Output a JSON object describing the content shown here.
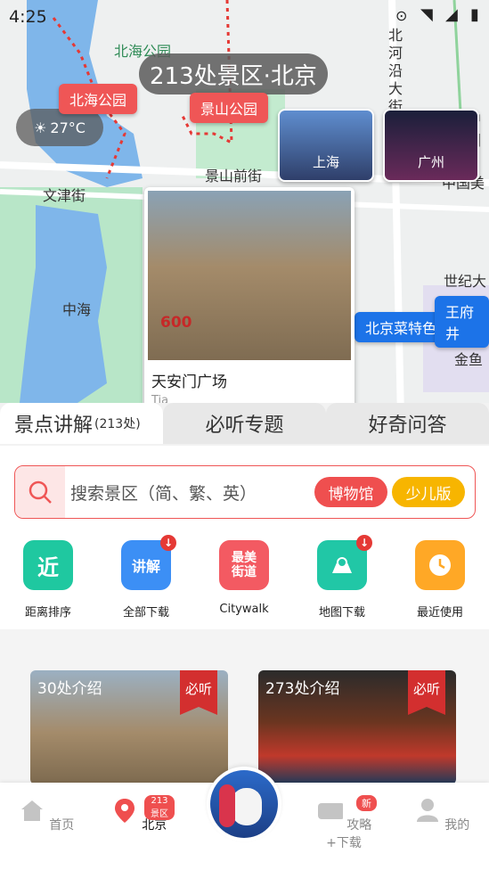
{
  "status_bar": {
    "time": "4:25"
  },
  "map": {
    "header_title": "213处景区·北京",
    "temperature": "27°C",
    "pins": {
      "beihai_park": "北海公园",
      "jingshan_park": "景山公园",
      "beijing_cuisine": "北京菜特色",
      "wangfujing": "王府井"
    },
    "labels": {
      "beihai_park_area": "北海公园",
      "jingshan_qian_street": "景山前街",
      "wenjin_street": "文津街",
      "zhonghai": "中海",
      "north_river": "北河沿大街",
      "zhongguo": "中国",
      "zhongguo_mei": "中国美",
      "shiji_da": "世纪大",
      "jinyu": "金鱼"
    },
    "cities": [
      "上海",
      "广州"
    ],
    "featured": {
      "title": "天安门广场",
      "subtitle": "Tia",
      "logo_text": "600"
    }
  },
  "tabs": [
    {
      "label": "景点讲解",
      "count": "(213处)"
    },
    {
      "label": "必听专题"
    },
    {
      "label": "好奇问答"
    }
  ],
  "search": {
    "placeholder": "搜索景区（简、繁、英）",
    "museum_chip": "博物馆",
    "kids_chip": "少儿版"
  },
  "quick_actions": [
    {
      "icon_text": "近",
      "label": "距离排序",
      "color": "#1fc8a0"
    },
    {
      "icon_text": "讲解",
      "label": "全部下载",
      "color": "#3c8ff5"
    },
    {
      "icon_text": "最美\n街道",
      "label": "Citywalk",
      "color": "#f35a62"
    },
    {
      "icon_text": "",
      "label": "地图下载",
      "color": "#21c7a6"
    },
    {
      "icon_text": "",
      "label": "最近使用",
      "color": "#ffa826"
    }
  ],
  "cards": [
    {
      "count": "30处介绍",
      "badge": "必听"
    },
    {
      "count": "273处介绍",
      "badge": "必听"
    }
  ],
  "bottom_nav": {
    "home": "首页",
    "beijing": "北京",
    "beijing_badge": "213景区",
    "guide": "攻略+下载",
    "guide_badge": "新",
    "mine": "我的"
  }
}
